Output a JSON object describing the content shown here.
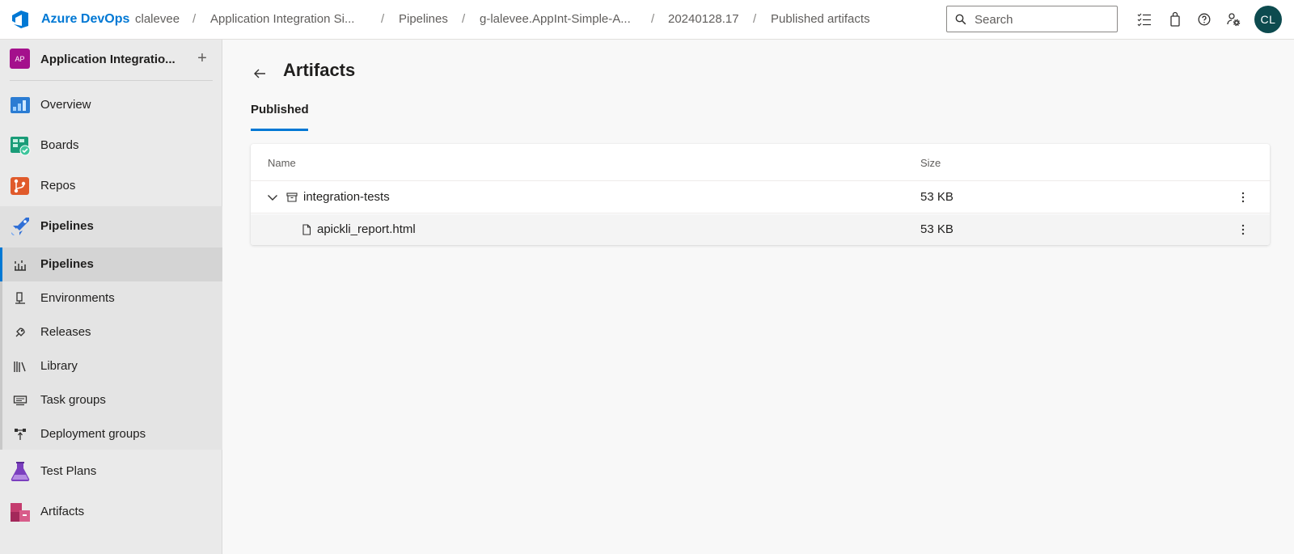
{
  "topbar": {
    "brand": "Azure DevOps",
    "breadcrumbs": [
      "clalevee",
      "Application Integration Si...",
      "Pipelines",
      "g-lalevee.AppInt-Simple-A...",
      "20240128.17",
      "Published artifacts"
    ],
    "separator": "/",
    "search_placeholder": "Search",
    "avatar_initials": "CL"
  },
  "sidebar": {
    "project_badge": "AP",
    "project_name": "Application Integratio...",
    "add_label": "+",
    "items": [
      {
        "label": "Overview",
        "icon": "overview-icon"
      },
      {
        "label": "Boards",
        "icon": "boards-icon"
      },
      {
        "label": "Repos",
        "icon": "repos-icon"
      },
      {
        "label": "Pipelines",
        "icon": "pipelines-icon"
      }
    ],
    "pipeline_sub": [
      {
        "label": "Pipelines",
        "icon": "pipelines-sub-icon"
      },
      {
        "label": "Environments",
        "icon": "environments-icon"
      },
      {
        "label": "Releases",
        "icon": "releases-icon"
      },
      {
        "label": "Library",
        "icon": "library-icon"
      },
      {
        "label": "Task groups",
        "icon": "task-groups-icon"
      },
      {
        "label": "Deployment groups",
        "icon": "deployment-groups-icon"
      }
    ],
    "bottom_items": [
      {
        "label": "Test Plans",
        "icon": "test-plans-icon"
      },
      {
        "label": "Artifacts",
        "icon": "artifacts-icon"
      }
    ]
  },
  "main": {
    "title": "Artifacts",
    "tab_label": "Published",
    "table": {
      "columns": [
        "Name",
        "Size"
      ],
      "rows": [
        {
          "name": "integration-tests",
          "size": "53 KB"
        },
        {
          "name": "apickli_report.html",
          "size": "53 KB"
        }
      ]
    }
  },
  "colors": {
    "accent": "#0078d4",
    "avatar_bg": "#0d4b4f",
    "project_badge_bg": "#a4108c"
  }
}
